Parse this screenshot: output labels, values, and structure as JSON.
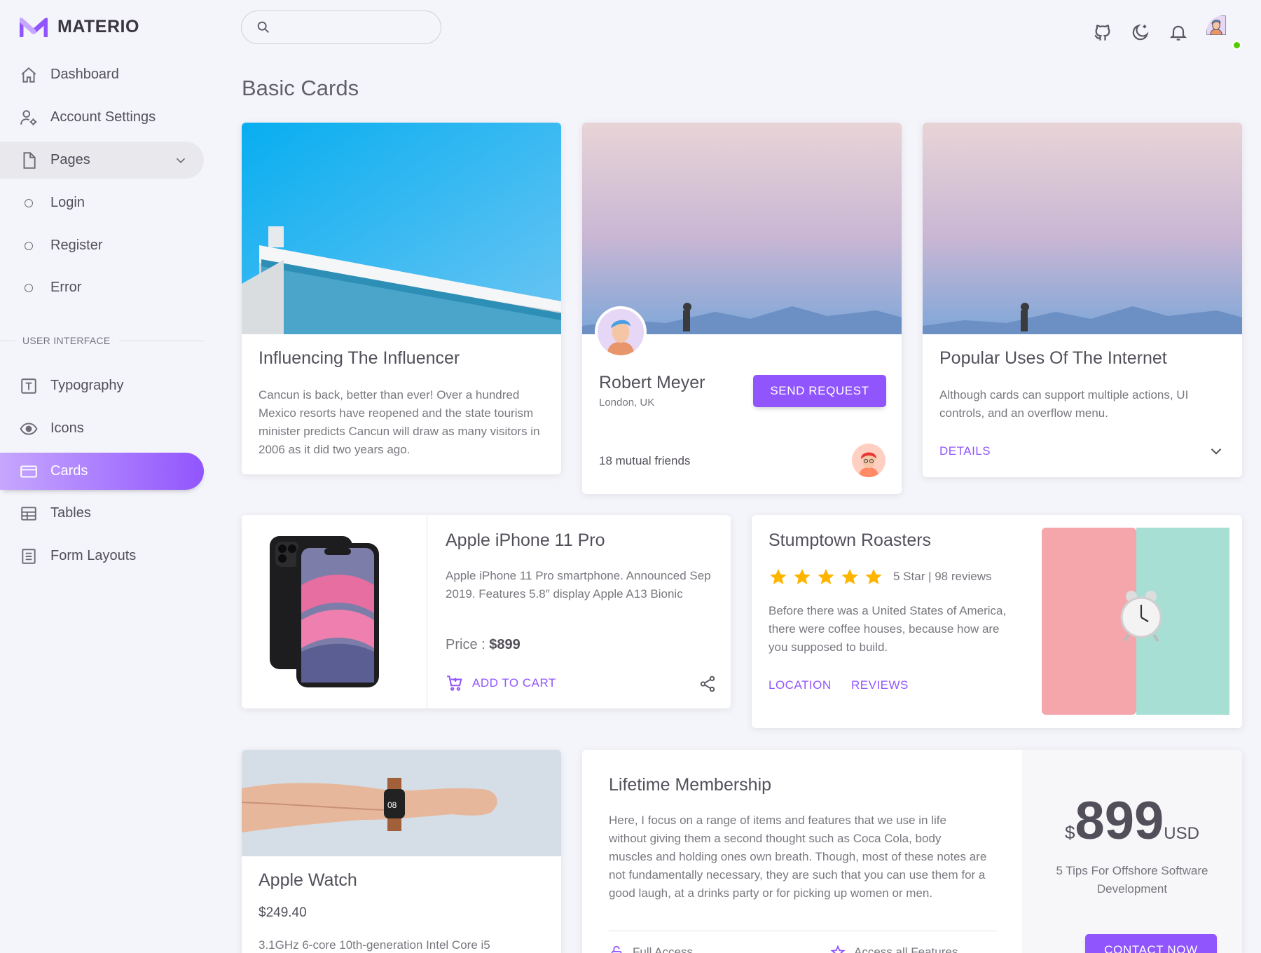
{
  "app": {
    "brand": "MATERIO"
  },
  "sidebar": {
    "items": [
      {
        "label": "Dashboard",
        "icon": "home-icon"
      },
      {
        "label": "Account Settings",
        "icon": "account-cog-icon"
      },
      {
        "label": "Pages",
        "icon": "file-icon"
      },
      {
        "label": "Login",
        "icon": "circle-icon"
      },
      {
        "label": "Register",
        "icon": "circle-icon"
      },
      {
        "label": "Error",
        "icon": "circle-icon"
      }
    ],
    "section_label": "USER INTERFACE",
    "ui_items": [
      {
        "label": "Typography",
        "icon": "typography-icon"
      },
      {
        "label": "Icons",
        "icon": "eye-icon"
      },
      {
        "label": "Cards",
        "icon": "credit-card-icon"
      },
      {
        "label": "Tables",
        "icon": "table-icon"
      },
      {
        "label": "Form Layouts",
        "icon": "form-icon"
      }
    ]
  },
  "search": {
    "placeholder": ""
  },
  "page": {
    "title": "Basic Cards"
  },
  "cards": {
    "influencer": {
      "title": "Influencing The Influencer",
      "text": "Cancun is back, better than ever! Over a hundred Mexico resorts have reopened and the state tourism minister predicts Cancun will draw as many visitors in 2006 as it did two years ago."
    },
    "profile": {
      "name": "Robert Meyer",
      "location": "London, UK",
      "button": "SEND REQUEST",
      "mutual": "18 mutual friends"
    },
    "internet": {
      "title": "Popular Uses Of The Internet",
      "text": "Although cards can support multiple actions, UI controls, and an overflow menu.",
      "link": "DETAILS"
    },
    "iphone": {
      "title": "Apple iPhone 11 Pro",
      "text": "Apple iPhone 11 Pro smartphone. Announced Sep 2019. Features 5.8″ display Apple A13 Bionic",
      "price_label": "Price : ",
      "price": "$899",
      "cart": "ADD TO CART"
    },
    "roasters": {
      "title": "Stumptown Roasters",
      "rating": 5,
      "rating_text": "5 Star | 98 reviews",
      "text": "Before there was a United States of America, there were coffee houses, because how are you supposed to build.",
      "link1": "LOCATION",
      "link2": "REVIEWS"
    },
    "watch": {
      "title": "Apple Watch",
      "price": "$249.40",
      "text": "3.1GHz 6-core 10th-generation Intel Core i5",
      "watch_time": "08"
    },
    "membership": {
      "title": "Lifetime Membership",
      "text": "Here, I focus on a range of items and features that we use in life without giving them a second thought such as Coca Cola, body muscles and holding ones own breath. Though, most of these notes are not fundamentally necessary, they are such that you can use them for a good laugh, at a drinks party or for picking up women or men.",
      "feature1": "Full Access",
      "feature2": "Access all Features",
      "currency": "$",
      "amount": "899",
      "unit": "USD",
      "subtitle": "5 Tips For Offshore Software Development",
      "button": "CONTACT NOW"
    }
  },
  "colors": {
    "primary": "#9155fd",
    "star": "#ffb400",
    "online": "#56ca00"
  }
}
